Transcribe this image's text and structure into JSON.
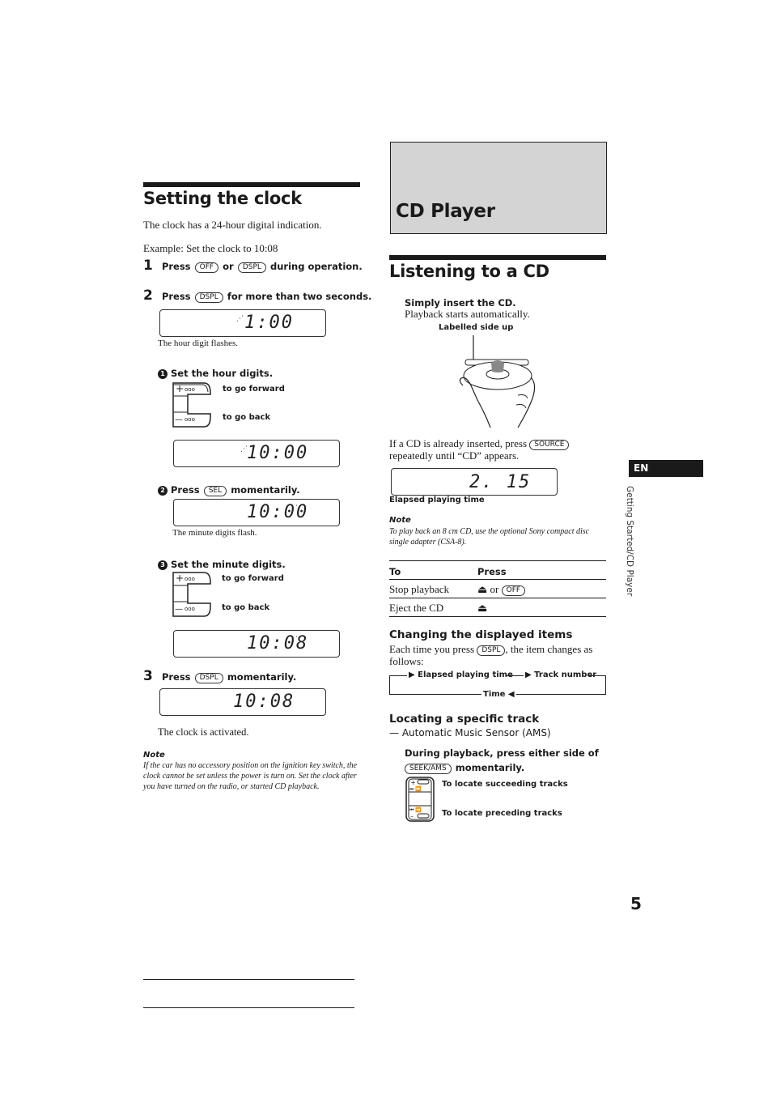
{
  "left": {
    "title": "Setting the clock",
    "intro": "The clock has a 24-hour digital indication.",
    "example": "Example: Set the clock to 10:08",
    "steps": [
      {
        "num": "1",
        "pre": "Press",
        "key1": "OFF",
        "mid": "or",
        "key2": "DSPL",
        "post": "during operation."
      },
      {
        "num": "2",
        "pre": "Press",
        "key1": "DSPL",
        "post": "for more than two seconds."
      },
      {
        "num": "3",
        "pre": "Press",
        "key1": "DSPL",
        "post": "momentarily."
      }
    ],
    "display1": {
      "value": "1:00",
      "caption": "The hour digit flashes."
    },
    "sub1": {
      "num": "1",
      "text": "Set the hour digits.",
      "forward": "to go forward",
      "back": "to go back"
    },
    "display2": {
      "value": "10:00"
    },
    "sub2": {
      "num": "2",
      "pre": "Press",
      "key": "SEL",
      "post": "momentarily."
    },
    "display3": {
      "value": "10:00",
      "caption": "The minute digits flash."
    },
    "sub3": {
      "num": "3",
      "text": "Set the minute digits.",
      "forward": "to go forward",
      "back": "to go back"
    },
    "display4": {
      "value": "10:08"
    },
    "display5": {
      "value": "10:08",
      "caption": "The clock is activated."
    },
    "note": {
      "title": "Note",
      "body": "If the car has no accessory position on the ignition key switch, the clock cannot be set unless the power is turn on. Set the clock after you have turned on the radio, or started CD playback."
    },
    "rocker": {
      "plus": "+",
      "minus": "—",
      "dots": "◦◦◦"
    }
  },
  "right": {
    "section_title": "CD Player",
    "title": "Listening to a CD",
    "insert_step": "Simply insert the CD.",
    "insert_sub": "Playback starts automatically.",
    "label_side": "Labelled side up",
    "already_pre": "If a CD is already inserted, press",
    "already_key": "SOURCE",
    "already_post": "repeatedly until “CD” appears.",
    "display": {
      "value": "2. 15",
      "caption": "Elapsed playing time"
    },
    "note": {
      "title": "Note",
      "body": "To play back an 8 cm CD, use the optional Sony compact disc single adapter (CSA-8)."
    },
    "table": {
      "headers": [
        "To",
        "Press"
      ],
      "rows": [
        {
          "to": "Stop playback",
          "eject": "⏏",
          "or": "or",
          "key": "OFF"
        },
        {
          "to": "Eject the CD",
          "eject": "⏏"
        }
      ]
    },
    "changing": {
      "title": "Changing the displayed items",
      "pre": "Each time you press",
      "key": "DSPL",
      "post": ", the item changes as follows:",
      "cycle": [
        "Elapsed playing time",
        "Track number",
        "Time"
      ]
    },
    "locating": {
      "title": "Locating a specific track",
      "subtitle": "— Automatic Music Sensor (AMS)",
      "step": "During playback, press either side of",
      "key": "SEEK/AMS",
      "step_post": "momentarily.",
      "succeeding": "To locate succeeding tracks",
      "preceding": "To locate preceding tracks"
    }
  },
  "side_tab": {
    "lang": "EN",
    "section": "Getting Started/CD Player"
  },
  "page_number": "5"
}
